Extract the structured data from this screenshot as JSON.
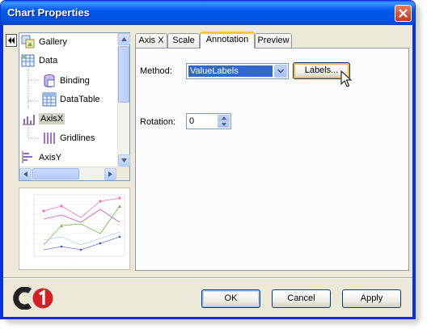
{
  "window": {
    "title": "Chart Properties"
  },
  "tree": {
    "items": [
      {
        "label": "Gallery",
        "icon": "gallery-icon"
      },
      {
        "label": "Data",
        "icon": "data-icon"
      },
      {
        "label": "Binding",
        "icon": "binding-icon"
      },
      {
        "label": "DataTable",
        "icon": "datatable-icon"
      },
      {
        "label": "AxisX",
        "icon": "axis-x-icon",
        "selected": true
      },
      {
        "label": "Gridlines",
        "icon": "gridlines-icon"
      },
      {
        "label": "AxisY",
        "icon": "axis-y-icon"
      }
    ]
  },
  "tabs": [
    {
      "label": "Axis X"
    },
    {
      "label": "Scale"
    },
    {
      "label": "Annotation",
      "active": true
    },
    {
      "label": "Preview"
    }
  ],
  "annotation": {
    "method_label": "Method:",
    "method_value": "ValueLabels",
    "labels_button": "Labels...",
    "rotation_label": "Rotation:",
    "rotation_value": "0"
  },
  "footer": {
    "logo": "C1",
    "ok": "OK",
    "cancel": "Cancel",
    "apply": "Apply"
  },
  "colors": {
    "title_bar": "#0058ee",
    "selection": "#316ac5",
    "tab_highlight": "#ffc73c"
  }
}
